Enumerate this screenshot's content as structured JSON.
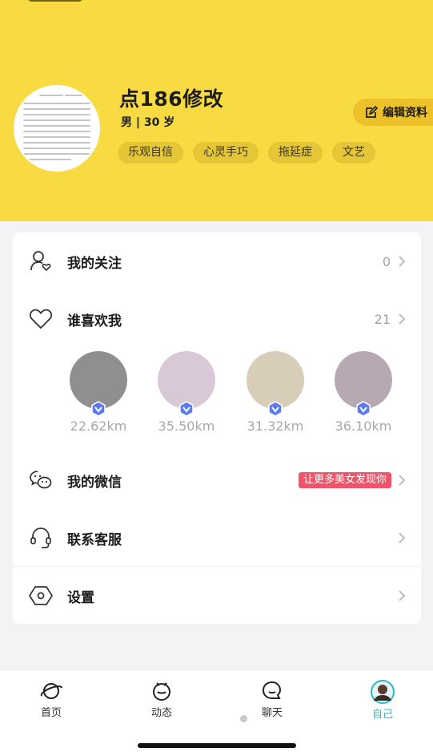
{
  "profile": {
    "name": "点186修改",
    "info": "男 | 30 岁",
    "tags": [
      "乐观自信",
      "心灵手巧",
      "拖延症",
      "文艺"
    ],
    "edit_label": "编辑资料"
  },
  "menu": {
    "following": {
      "label": "我的关注",
      "count": "0"
    },
    "likes": {
      "label": "谁喜欢我",
      "count": "21"
    },
    "likers": [
      {
        "distance": "22.62km",
        "color": "#8f8f8f"
      },
      {
        "distance": "35.50km",
        "color": "#d9c8d6"
      },
      {
        "distance": "31.32km",
        "color": "#d8cdb9"
      },
      {
        "distance": "36.10km",
        "color": "#b6a9b2"
      }
    ],
    "wechat": {
      "label": "我的微信",
      "promo": "让更多美女发现你"
    },
    "service": {
      "label": "联系客服"
    },
    "settings": {
      "label": "设置"
    }
  },
  "tabbar": {
    "items": [
      {
        "label": "首页",
        "icon": "planet-icon"
      },
      {
        "label": "动态",
        "icon": "face-icon"
      },
      {
        "label": "聊天",
        "icon": "chat-bubble-icon"
      },
      {
        "label": "自己",
        "icon": "user-avatar-icon"
      }
    ],
    "active_index": 3
  },
  "colors": {
    "header_bg": "#f8da43",
    "accent": "#2fb7c0",
    "verified_badge": "#5b7cf0",
    "promo_bg": "#f0546a"
  }
}
